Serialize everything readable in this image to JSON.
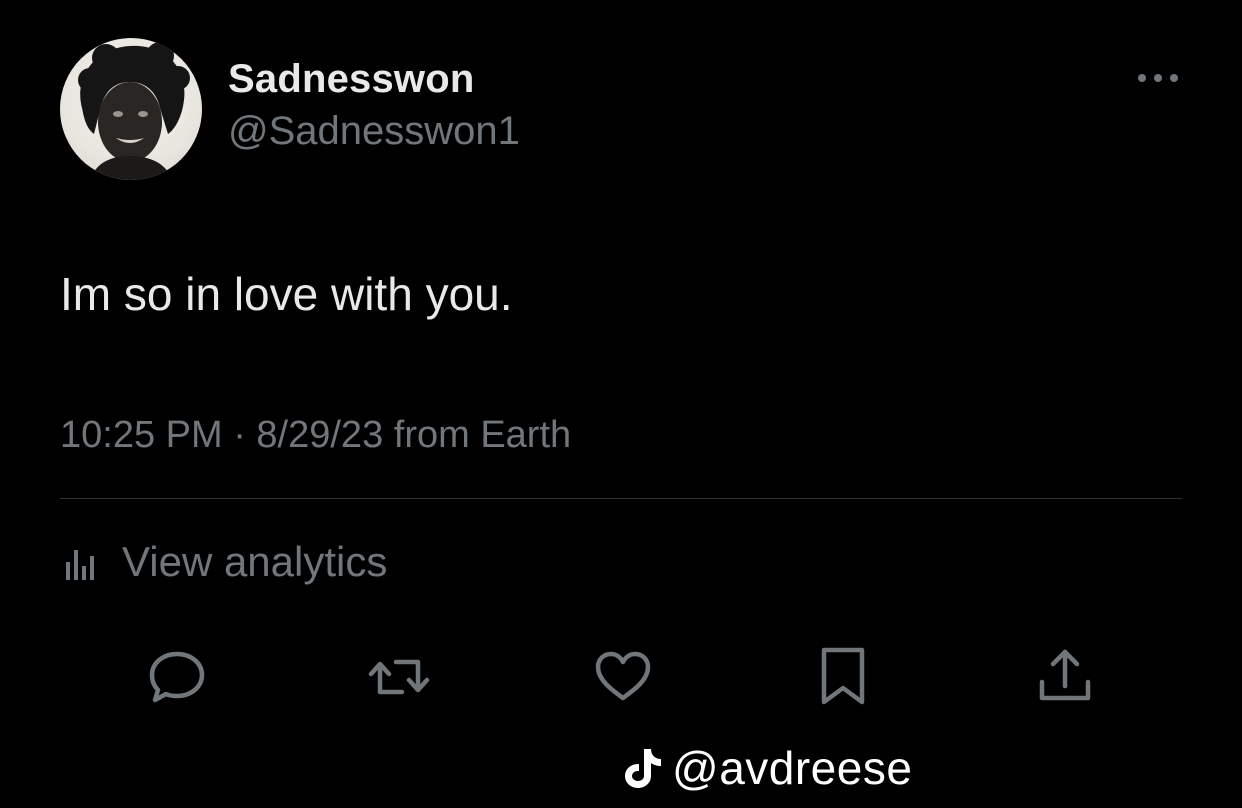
{
  "tweet": {
    "author": {
      "display_name": "Sadnesswon",
      "handle": "@Sadnesswon1",
      "avatar_icon": "profile-photo"
    },
    "text": "Im so in love with you.",
    "meta": "10:25 PM · 8/29/23 from Earth",
    "more_icon": "more-horizontal-icon"
  },
  "analytics": {
    "label": "View analytics",
    "icon": "analytics-bars-icon"
  },
  "actions": [
    {
      "name": "reply",
      "icon": "speech-bubble-icon"
    },
    {
      "name": "retweet",
      "icon": "retweet-arrows-icon"
    },
    {
      "name": "like",
      "icon": "heart-icon"
    },
    {
      "name": "bookmark",
      "icon": "bookmark-icon"
    },
    {
      "name": "share",
      "icon": "share-upload-icon"
    }
  ],
  "watermark": {
    "text": "@avdreese",
    "icon": "tiktok-note-icon"
  },
  "colors": {
    "background": "#000000",
    "primary_text": "#e7e9ea",
    "secondary_text": "#71767b",
    "divider": "#2f3336"
  }
}
